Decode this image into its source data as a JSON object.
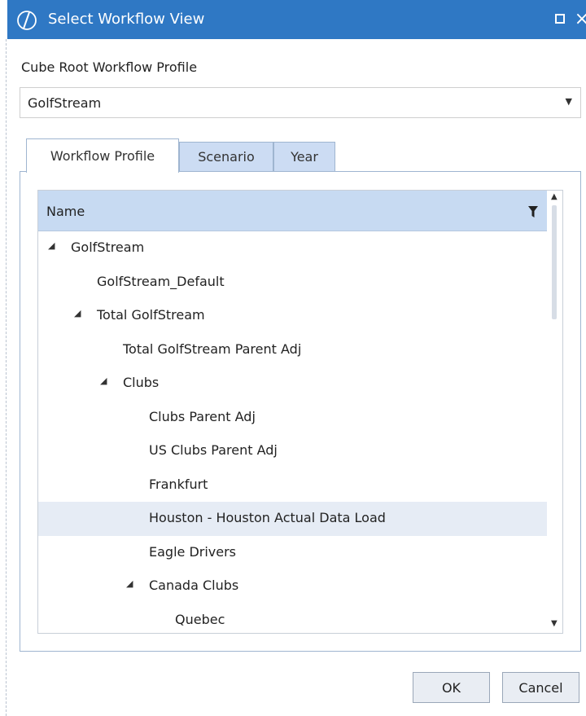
{
  "window": {
    "title": "Select Workflow View",
    "icon": "onestream-logo-icon",
    "controls": [
      "maximize-icon",
      "close-icon"
    ],
    "close_glyph": "×"
  },
  "profile": {
    "label": "Cube Root Workflow Profile",
    "value": "GolfStream"
  },
  "tabs": [
    {
      "label": "Workflow Profile",
      "active": true
    },
    {
      "label": "Scenario",
      "active": false
    },
    {
      "label": "Year",
      "active": false
    }
  ],
  "tree": {
    "column_header": "Name",
    "rows": [
      {
        "label": "GolfStream",
        "expanded": true,
        "has_children": true,
        "level": 0
      },
      {
        "label": "GolfStream_Default",
        "has_children": false,
        "level": 1
      },
      {
        "label": "Total GolfStream",
        "expanded": true,
        "has_children": true,
        "level": 1
      },
      {
        "label": "Total GolfStream Parent Adj",
        "has_children": false,
        "level": 2
      },
      {
        "label": "Clubs",
        "expanded": true,
        "has_children": true,
        "level": 2
      },
      {
        "label": "Clubs Parent Adj",
        "has_children": false,
        "level": 3
      },
      {
        "label": "US Clubs Parent Adj",
        "has_children": false,
        "level": 3
      },
      {
        "label": "Frankfurt",
        "has_children": false,
        "level": 3
      },
      {
        "label": "Houston - Houston Actual Data Load",
        "has_children": false,
        "level": 3,
        "selected": true
      },
      {
        "label": "Eagle Drivers",
        "has_children": false,
        "level": 3
      },
      {
        "label": "Canada Clubs",
        "expanded": true,
        "has_children": true,
        "level": 3
      },
      {
        "label": "Quebec",
        "has_children": false,
        "level": 4
      }
    ]
  },
  "buttons": {
    "ok": "OK",
    "cancel": "Cancel"
  },
  "colors": {
    "titlebar": "#2f78c4",
    "tab_inactive": "#ccdcf3",
    "header_bg": "#c7daf2",
    "selected_row": "#e6ecf5"
  }
}
